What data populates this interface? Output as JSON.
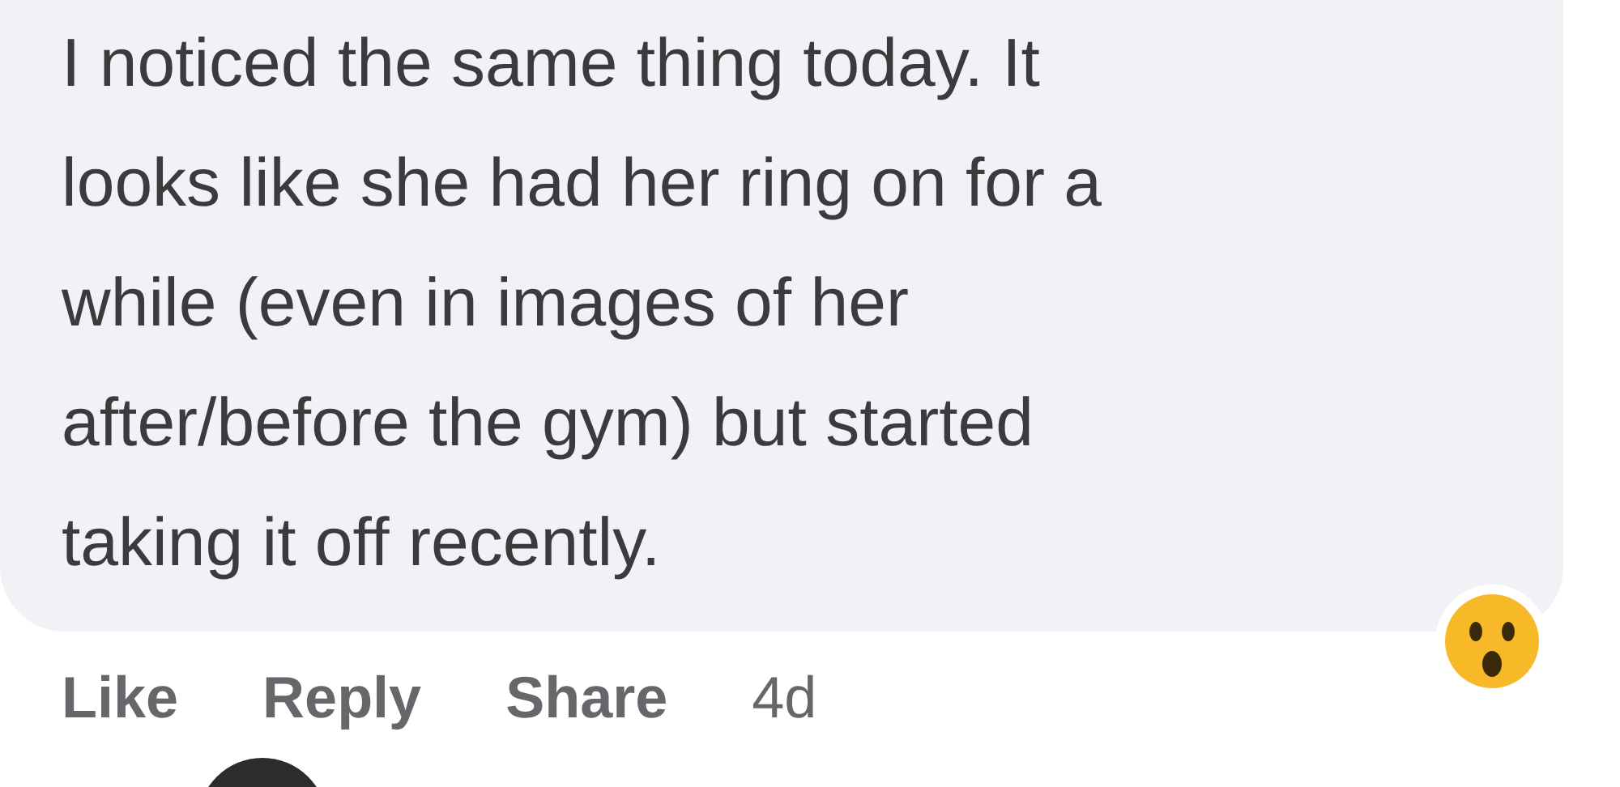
{
  "comment": {
    "text_lines": [
      "I noticed the same thing today. It",
      "looks like she had her ring on for a",
      "while (even in images of her",
      "after/before the gym) but started",
      "taking it off recently."
    ],
    "reaction": {
      "kind": "wow"
    }
  },
  "actions": [
    {
      "label": "Like",
      "kind": "link"
    },
    {
      "label": "Reply",
      "kind": "link"
    },
    {
      "label": "Share",
      "kind": "link"
    },
    {
      "label": "4d",
      "kind": "time"
    }
  ],
  "next_comment": {
    "kind": "avatar"
  }
}
